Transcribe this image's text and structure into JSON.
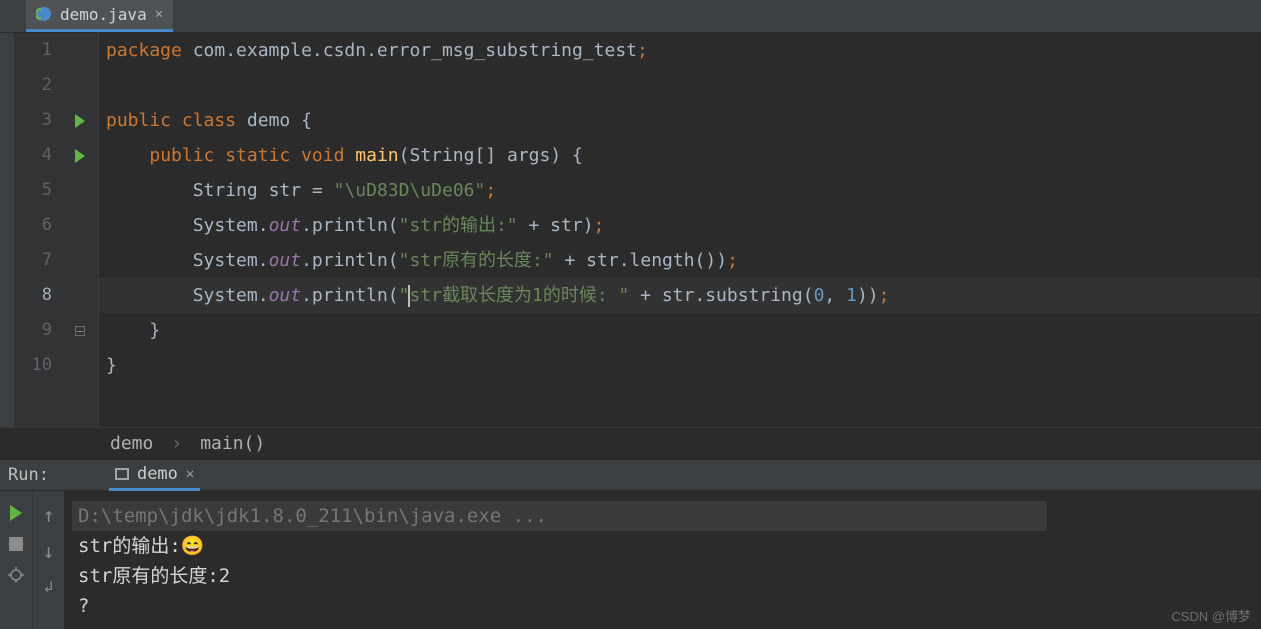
{
  "tab": {
    "filename": "demo.java"
  },
  "code": {
    "package_kw": "package ",
    "package_name": "com.example.csdn.error_msg_substring_test",
    "sc": ";",
    "public_kw": "public ",
    "class_kw": "class ",
    "class_name": "demo ",
    "ob": "{",
    "cb": "}",
    "static_kw": "static ",
    "void_kw": "void ",
    "main_fn": "main",
    "mparams": "(String[] args) ",
    "string_ty": "String ",
    "var": "str ",
    "eq": "= ",
    "lit1": "\"\\uD83D\\uDe06\"",
    "sys": "System.",
    "out": "out",
    "dot": ".",
    "println": "println",
    "op": "(",
    "cp": ")",
    "comma": ", ",
    "l6s": "\"str的输出:\"",
    "plus": " + ",
    "strv": "str",
    "l7s": "\"str原有的长度:\"",
    "len": ".length()",
    "l8a": "\"",
    "l8b": "str截取长度为1的时候: \"",
    "sub": ".substring(",
    "n0": "0",
    "n1": "1"
  },
  "gutter": {
    "l1": "1",
    "l2": "2",
    "l3": "3",
    "l4": "4",
    "l5": "5",
    "l6": "6",
    "l7": "7",
    "l8": "8",
    "l9": "9",
    "l10": "10",
    "current": "8"
  },
  "breadcrumb": {
    "a": "demo",
    "b": "main()"
  },
  "run": {
    "label": "Run:",
    "tab": "demo",
    "out0": "D:\\temp\\jdk\\jdk1.8.0_211\\bin\\java.exe ...",
    "out1": "str的输出:😄",
    "out2": "str原有的长度:2",
    "out3": "?"
  },
  "watermark": "CSDN @博梦"
}
